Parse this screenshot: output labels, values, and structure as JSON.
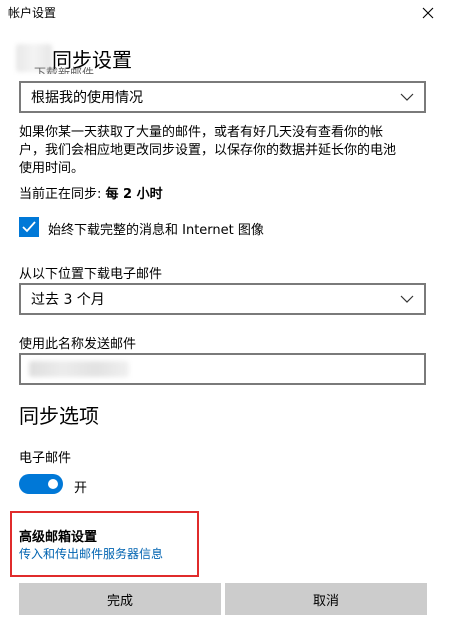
{
  "window": {
    "title": "帐户设置"
  },
  "sync_settings": {
    "title": "同步设置",
    "clipped_label": "下载新邮件",
    "download_frequency": "根据我的使用情况",
    "description": "如果你某一天获取了大量的邮件，或者有好几天没有查看你的帐户，我们会相应地更改同步设置，以保存你的数据并延长你的电池使用时间。",
    "description_line1": "如果你某一天获取了大量的邮件，或者有好几天没有查看你的帐",
    "description_line2": "户，我们会相应地更改同步设置，以保存你的数据并延长你的电池",
    "description_line3": "使用时间。",
    "current_sync_prefix": "当前正在同步: ",
    "current_sync_value": "每 2 小时",
    "always_download_label": "始终下载完整的消息和 Internet 图像",
    "always_download_checked": true,
    "download_from_label": "从以下位置下载电子邮件",
    "download_from_value": "过去 3 个月",
    "send_name_label": "使用此名称发送邮件"
  },
  "sync_options": {
    "title": "同步选项",
    "email_label": "电子邮件",
    "email_toggle_state": "开",
    "email_toggle_on": true
  },
  "advanced": {
    "title": "高级邮箱设置",
    "link": "传入和传出邮件服务器信息"
  },
  "footer": {
    "done": "完成",
    "cancel": "取消"
  },
  "colors": {
    "accent": "#0078d7",
    "link": "#0063b1",
    "highlight": "#e02b2b",
    "button": "#cccccc"
  }
}
